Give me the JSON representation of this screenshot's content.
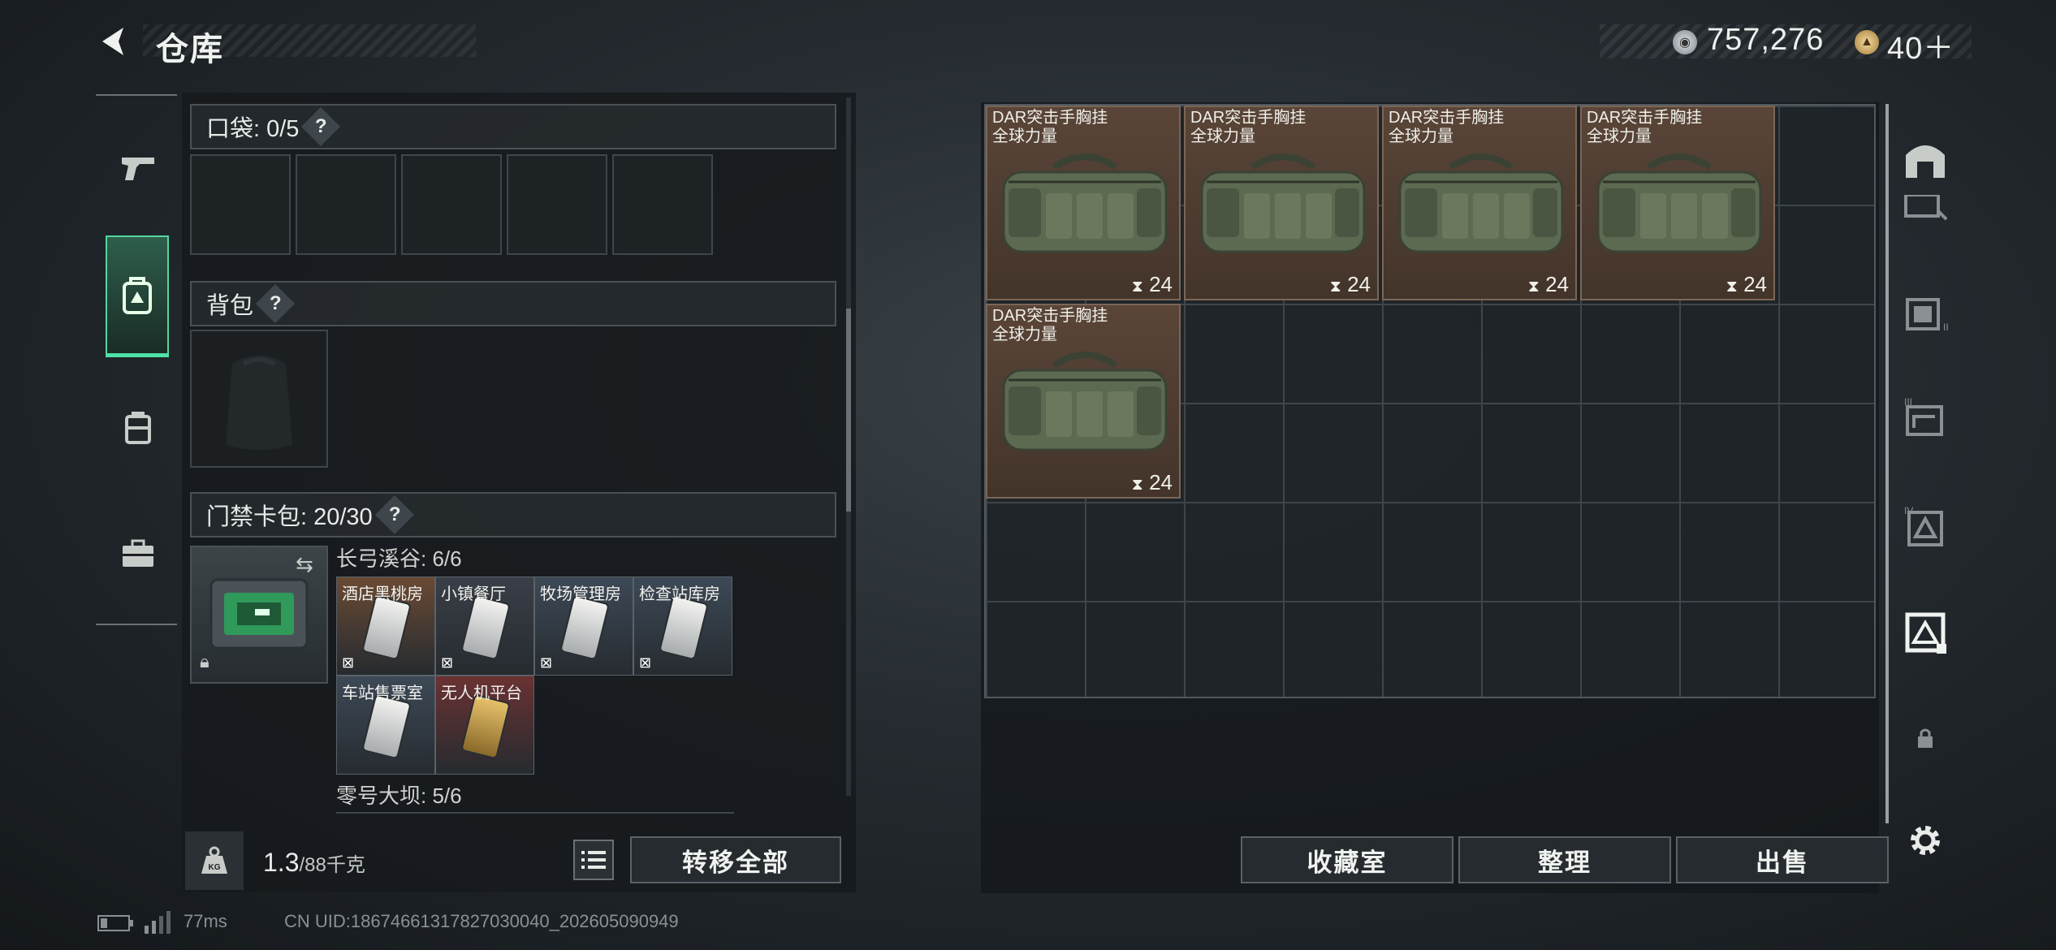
{
  "header": {
    "title": "仓库",
    "currency1": "757,276",
    "currency2": "40＋"
  },
  "sidebar": {
    "items": [
      {
        "name": "weapon-tab"
      },
      {
        "name": "equipment-tab",
        "active": true
      },
      {
        "name": "backpack-tab"
      },
      {
        "name": "case-tab"
      }
    ]
  },
  "left": {
    "pocket_label": "口袋: 0/5",
    "backpack_label": "背包",
    "keycard_label": "门禁卡包: 20/30",
    "zone1_label": "长弓溪谷: 6/6",
    "zone2_label": "零号大坝: 5/6",
    "keycards": [
      {
        "name": "酒店黑桃房",
        "color": "#6a4a34"
      },
      {
        "name": "小镇餐厅",
        "color": "#3a3f48"
      },
      {
        "name": "牧场管理房",
        "color": "#3d4956"
      },
      {
        "name": "检查站库房",
        "color": "#3d4956"
      },
      {
        "name": "车站售票室",
        "color": "#3d4956"
      },
      {
        "name": "无人机平台",
        "color": "#6a3232"
      }
    ],
    "weight_value": "1.3",
    "weight_unit": "/88千克",
    "transfer_all": "转移全部"
  },
  "stash": {
    "items": [
      {
        "name1": "DAR突击手胸挂",
        "name2": "全球力量",
        "qty": "24"
      },
      {
        "name1": "DAR突击手胸挂",
        "name2": "全球力量",
        "qty": "24"
      },
      {
        "name1": "DAR突击手胸挂",
        "name2": "全球力量",
        "qty": "24"
      },
      {
        "name1": "DAR突击手胸挂",
        "name2": "全球力量",
        "qty": "24"
      },
      {
        "name1": "DAR突击手胸挂",
        "name2": "全球力量",
        "qty": "24"
      }
    ],
    "collection_btn": "收藏室",
    "sort_btn": "整理",
    "sell_btn": "出售"
  },
  "footer": {
    "ping": "77ms",
    "uid": "CN UID:18674661317827030040_202605090949"
  },
  "colors": {
    "accent": "#4fe0a6",
    "item_bg": "#4e3d31"
  }
}
